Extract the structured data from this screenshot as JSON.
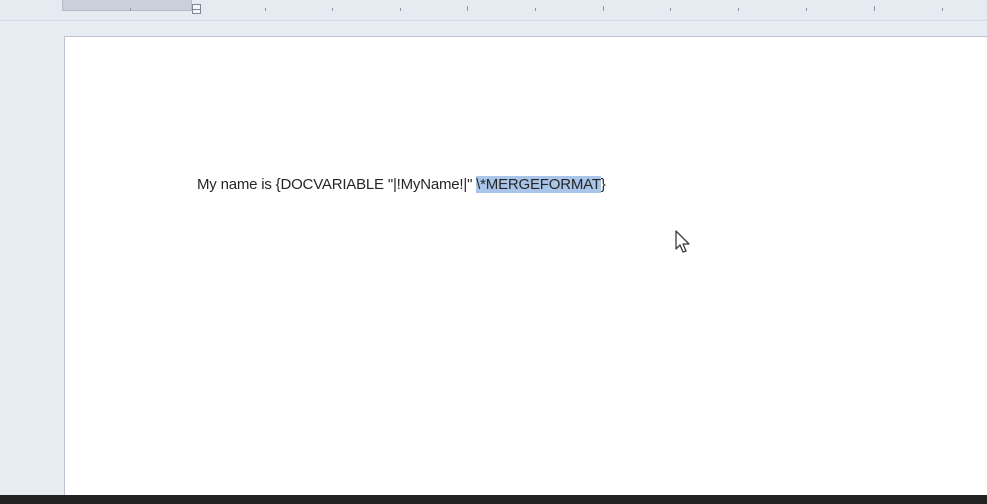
{
  "document": {
    "line_prefix": "My name is {DOCVARIABLE \"|!MyName!|\" ",
    "line_selected": "\\*MERGEFORMAT",
    "line_suffix": "}"
  },
  "colors": {
    "selection": "#a9c6ea",
    "page": "#ffffff",
    "background": "#e8ecf3"
  },
  "icons": {
    "cursor": "mouse-pointer-icon",
    "indent": "indent-marker-icon"
  }
}
